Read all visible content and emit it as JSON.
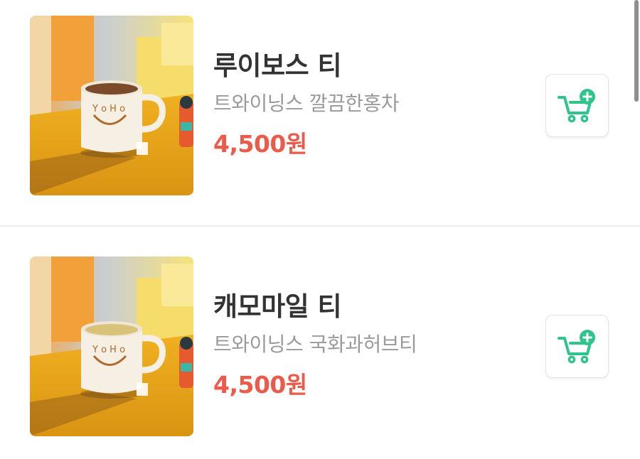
{
  "products": [
    {
      "name": "루이보스 티",
      "description": "트와이닝스 깔끔한홍차",
      "price": "4,500원",
      "image_icon": "tea-mug-photo"
    },
    {
      "name": "캐모마일 티",
      "description": "트와이닝스 국화과허브티",
      "price": "4,500원",
      "image_icon": "tea-mug-photo"
    }
  ],
  "cart_icon": "cart-add-icon",
  "colors": {
    "price": "#ec5a4a",
    "accent_green": "#2fc48d",
    "name": "#333333",
    "description": "#9a9a9a"
  }
}
